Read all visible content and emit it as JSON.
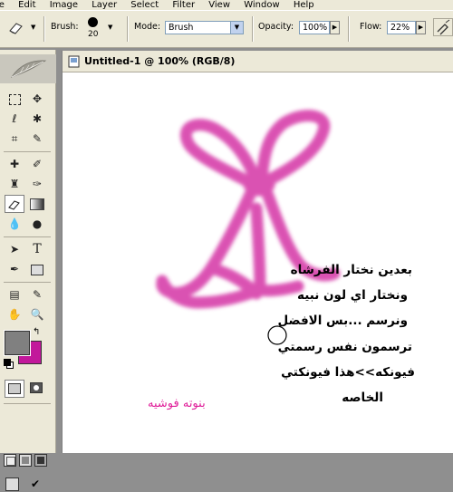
{
  "menu": [
    "le",
    "Edit",
    "Image",
    "Layer",
    "Select",
    "Filter",
    "View",
    "Window",
    "Help"
  ],
  "options_bar": {
    "tool_icon": "eraser-icon",
    "brush_label": "Brush:",
    "brush_size": "20",
    "mode_label": "Mode:",
    "mode_value": "Brush",
    "opacity_label": "Opacity:",
    "opacity_value": "100%",
    "flow_label": "Flow:",
    "flow_value": "22%"
  },
  "document": {
    "title": "Untitled-1 @ 100% (RGB/8)"
  },
  "canvas": {
    "stroke_color": "#d63aa8",
    "arabic_lines": [
      "بعدين نختار الفرشاه",
      "ونختار اي لون نبيه",
      "ونرسم ...بس الافضل",
      "ترسمون نفس رسمتي",
      "فيونكه>>هذا فيونكتي",
      "الخاصه"
    ],
    "signature": "بنوته فوشيه",
    "signature_color": "#e0209a"
  },
  "colors": {
    "foreground": "#808080",
    "background": "#c2189b",
    "ui_face": "#ece9d8",
    "workspace": "#8f8f8f"
  }
}
